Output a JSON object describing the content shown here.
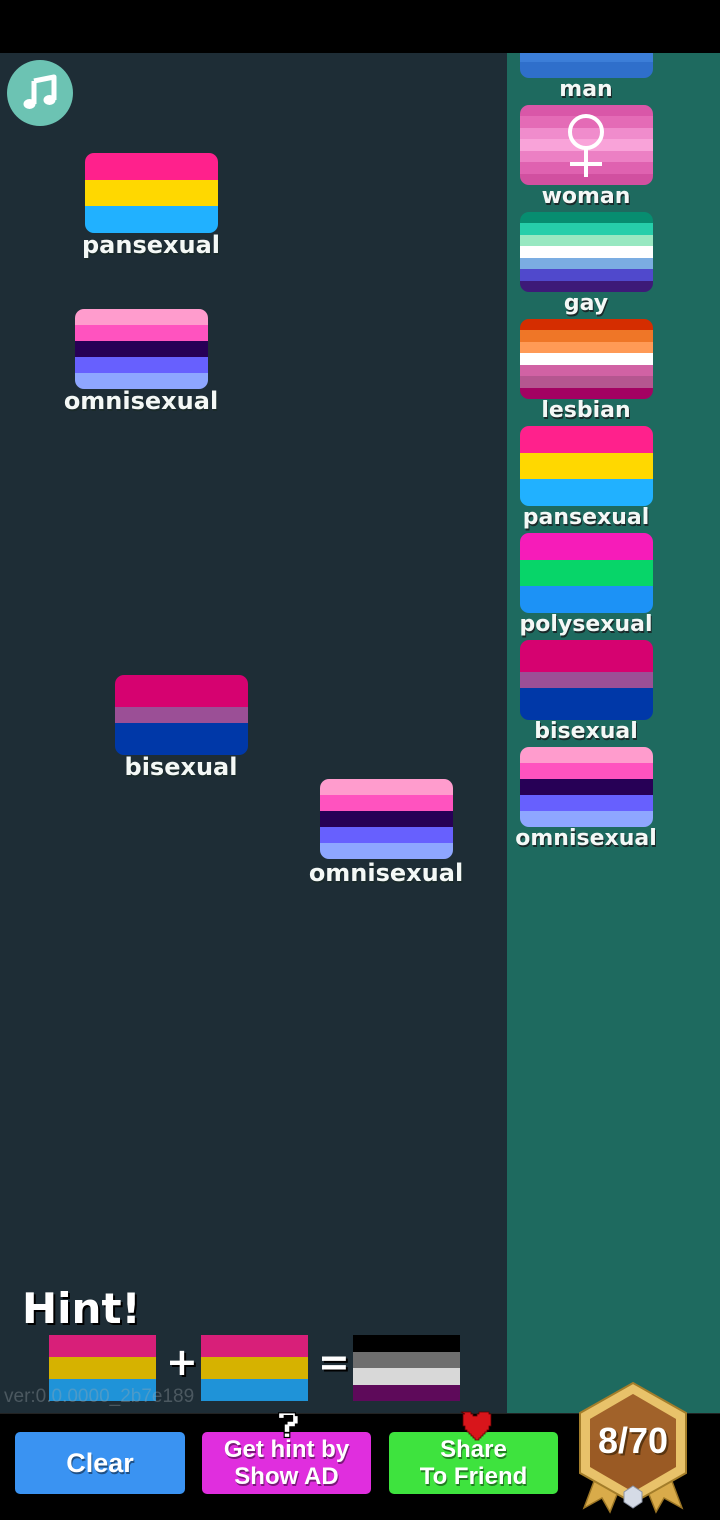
{
  "game": {
    "progress_text": "8/70",
    "progress": {
      "found": 8,
      "total": 70
    },
    "version": "ver:0.0.0000_2b7e189"
  },
  "board": {
    "items": [
      {
        "name": "pansexual",
        "stripes": [
          "#ff218c",
          "#ffd800",
          "#21b1ff"
        ]
      },
      {
        "name": "omnisexual",
        "stripes": [
          "#ff9ccd",
          "#ff53bf",
          "#270056",
          "#6760fe",
          "#8ea6ff"
        ]
      },
      {
        "name": "bisexual",
        "stripes": [
          "#d60270",
          "#d60270",
          "#9b4f96",
          "#0038a8",
          "#0038a8"
        ]
      },
      {
        "name": "omnisexual",
        "stripes": [
          "#ff9ccd",
          "#ff53bf",
          "#270056",
          "#6760fe",
          "#8ea6ff"
        ]
      }
    ]
  },
  "sidebar": {
    "items": [
      {
        "name": "man",
        "stripes": [
          "#4a8de8",
          "#5d9bec",
          "#4a8de8",
          "#3c7ed8",
          "#2f6fcb"
        ],
        "symbol": "male"
      },
      {
        "name": "woman",
        "stripes": [
          "#d957a8",
          "#e46bb6",
          "#f08ccc",
          "#f9a3d9",
          "#ec80c4",
          "#df62b0",
          "#d150a0"
        ],
        "symbol": "female"
      },
      {
        "name": "gay",
        "stripes": [
          "#078d70",
          "#26ceaa",
          "#98e8c1",
          "#ffffff",
          "#7bade2",
          "#5049cc",
          "#3d1a78"
        ]
      },
      {
        "name": "lesbian",
        "stripes": [
          "#d52d00",
          "#ef7627",
          "#ff9a56",
          "#ffffff",
          "#d162a4",
          "#b55690",
          "#a30262"
        ]
      },
      {
        "name": "pansexual",
        "stripes": [
          "#ff218c",
          "#ffd800",
          "#21b1ff"
        ]
      },
      {
        "name": "polysexual",
        "stripes": [
          "#f61cb9",
          "#07d569",
          "#1c92f6"
        ]
      },
      {
        "name": "bisexual",
        "stripes": [
          "#d60270",
          "#d60270",
          "#9b4f96",
          "#0038a8",
          "#0038a8"
        ]
      },
      {
        "name": "omnisexual",
        "stripes": [
          "#ff9ccd",
          "#ff53bf",
          "#270056",
          "#6760fe",
          "#8ea6ff"
        ]
      }
    ]
  },
  "hint": {
    "title": "Hint!",
    "plus": "+",
    "equals": "=",
    "left": {
      "name": "pansexual",
      "stripes": [
        "#d81f79",
        "#d6b200",
        "#1f93d8"
      ]
    },
    "right": {
      "name": "pansexual",
      "stripes": [
        "#d81f79",
        "#d6b200",
        "#1f93d8"
      ]
    },
    "result": {
      "name": "asexual",
      "stripes": [
        "#000000",
        "#6e6e6e",
        "#d8d8d8",
        "#5e0a5a"
      ]
    }
  },
  "buttons": {
    "clear": "Clear",
    "hint_line1": "Get hint by",
    "hint_line2": "Show AD",
    "share_line1": "Share",
    "share_line2": "To Friend"
  },
  "colors": {
    "board_bg": "#1e2d36",
    "panel_bg": "#1e6a5f",
    "clear_btn": "#3a93f2",
    "hint_btn": "#e02ede",
    "share_btn": "#3ee33e"
  }
}
